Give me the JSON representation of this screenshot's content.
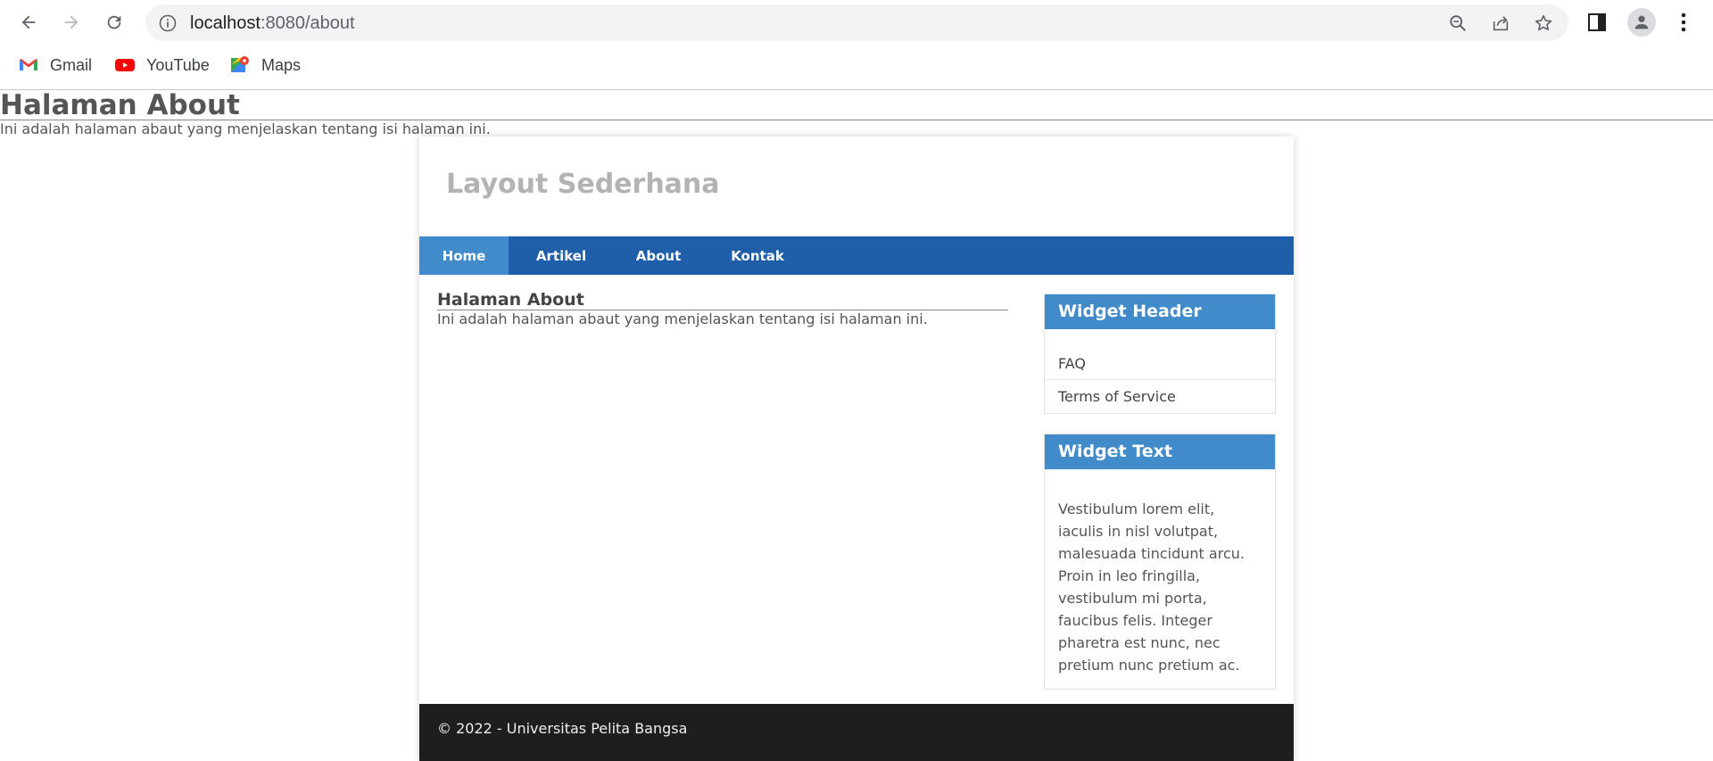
{
  "browser": {
    "url_host": "localhost",
    "url_path": ":8080/about",
    "bookmarks": [
      {
        "label": "Gmail",
        "icon": "gmail-icon"
      },
      {
        "label": "YouTube",
        "icon": "youtube-icon"
      },
      {
        "label": "Maps",
        "icon": "maps-icon"
      }
    ]
  },
  "page": {
    "top_title": "Halaman About",
    "top_desc": "Ini adalah halaman abaut yang menjelaskan tentang isi halaman ini."
  },
  "site": {
    "title": "Layout Sederhana",
    "nav": [
      {
        "label": "Home",
        "active": true
      },
      {
        "label": "Artikel",
        "active": false
      },
      {
        "label": "About",
        "active": false
      },
      {
        "label": "Kontak",
        "active": false
      }
    ],
    "main": {
      "title": "Halaman About",
      "desc": "Ini adalah halaman abaut yang menjelaskan tentang isi halaman ini."
    },
    "widgets": {
      "header_title": "Widget Header",
      "links": [
        "FAQ",
        "Terms of Service"
      ],
      "text_title": "Widget Text",
      "text_body": "Vestibulum lorem elit, iaculis in nisl volutpat, malesuada tincidunt arcu. Proin in leo fringilla, vestibulum mi porta, faucibus felis. Integer pharetra est nunc, nec pretium nunc pretium ac."
    },
    "footer": "© 2022 - Universitas Pelita Bangsa"
  },
  "colors": {
    "nav_bg": "#1f5faa",
    "nav_active": "#428bca",
    "widget_header": "#428bca",
    "footer_bg": "#1e1e1e"
  }
}
